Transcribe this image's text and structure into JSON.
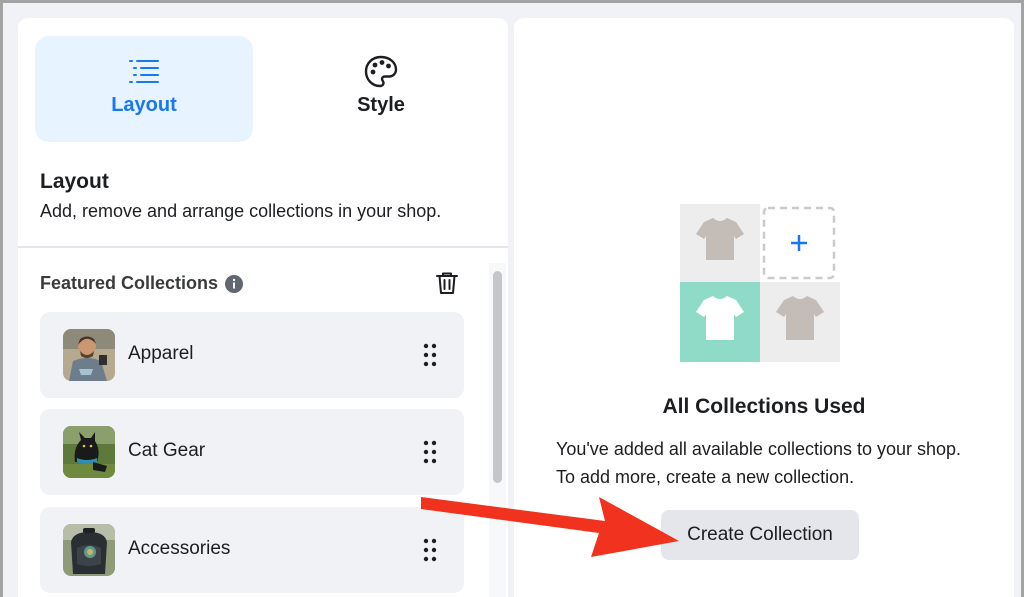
{
  "tabs": [
    {
      "label": "Layout",
      "icon": "list-icon",
      "active": true
    },
    {
      "label": "Style",
      "icon": "palette-icon",
      "active": false
    }
  ],
  "layout_section": {
    "title": "Layout",
    "description": "Add, remove and arrange collections in your shop."
  },
  "featured": {
    "title": "Featured Collections",
    "items": [
      {
        "name": "Apparel"
      },
      {
        "name": "Cat Gear"
      },
      {
        "name": "Accessories"
      }
    ]
  },
  "empty_state": {
    "title": "All Collections Used",
    "description": "You've added all available collections to your shop. To add more, create a new collection.",
    "button_label": "Create Collection"
  },
  "colors": {
    "accent": "#1877f2",
    "active_tab_bg": "#e7f3ff",
    "annotation_arrow": "#f0321e",
    "illustration_teal": "#8fdbc8"
  }
}
